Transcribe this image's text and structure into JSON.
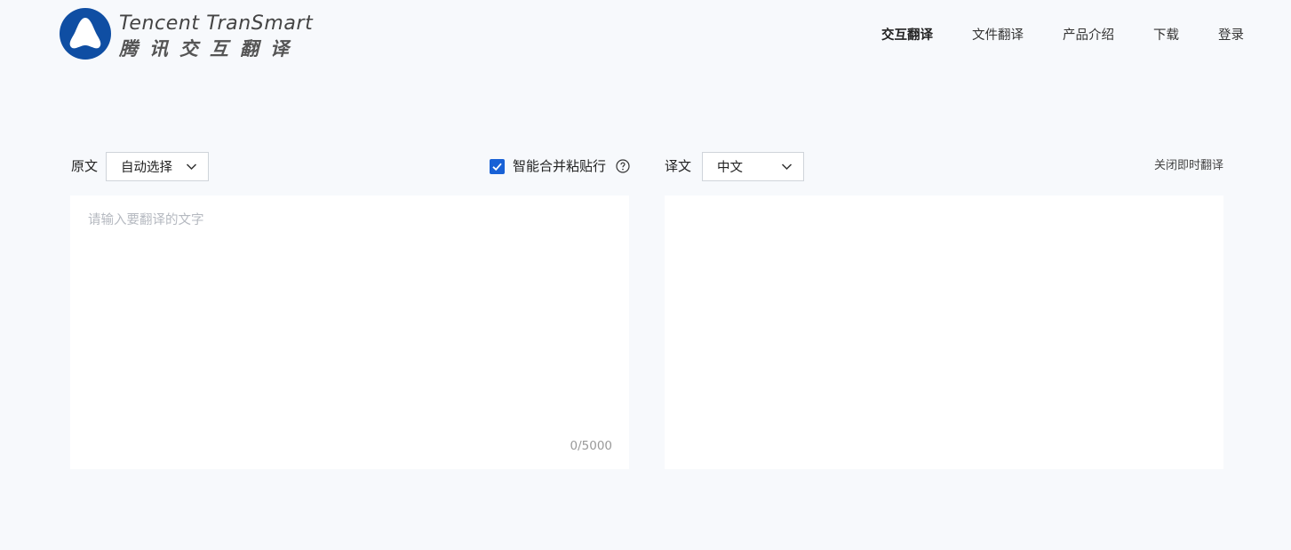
{
  "brand": {
    "name_en": "Tencent TranSmart",
    "name_cn": "腾讯交互翻译",
    "logo_color": "#0f4ea3"
  },
  "nav": {
    "items": [
      {
        "label": "交互翻译",
        "active": true
      },
      {
        "label": "文件翻译",
        "active": false
      },
      {
        "label": "产品介绍",
        "active": false
      },
      {
        "label": "下载",
        "active": false
      },
      {
        "label": "登录",
        "active": false
      }
    ]
  },
  "source": {
    "label": "原文",
    "language": "自动选择",
    "placeholder": "请输入要翻译的文字",
    "counter": "0/5000"
  },
  "options": {
    "smart_merge_label": "智能合并粘贴行",
    "smart_merge_checked": true,
    "help_icon": "question-circle-icon",
    "checkbox_color": "#1861d6"
  },
  "target": {
    "label": "译文",
    "language": "中文",
    "close_instant_label": "关闭即时翻译"
  }
}
